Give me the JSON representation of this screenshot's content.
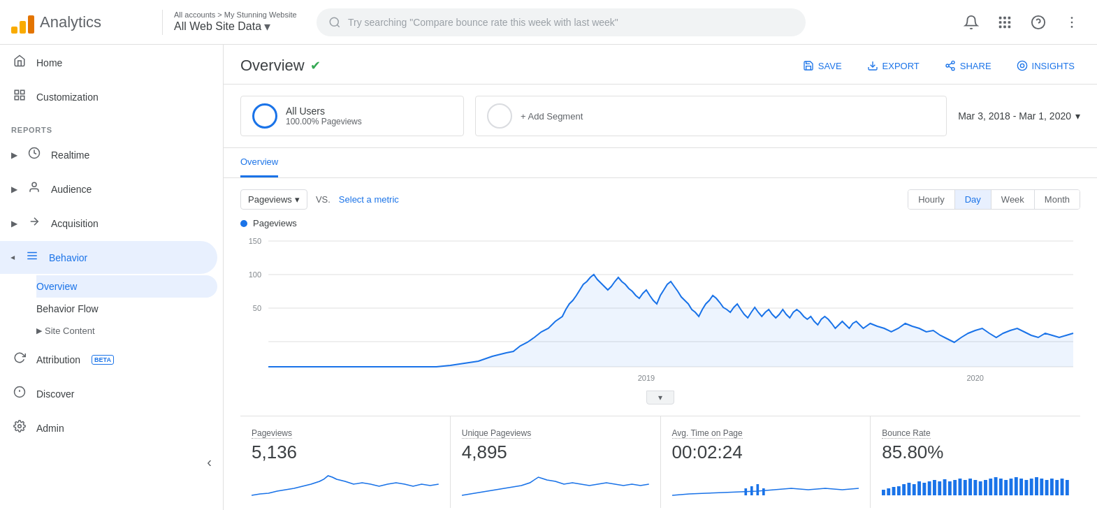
{
  "topbar": {
    "logo_title": "Analytics",
    "account_path": "All accounts > My Stunning Website",
    "account_name": "All Web Site Data",
    "search_placeholder": "Try searching \"Compare bounce rate this week with last week\""
  },
  "sidebar": {
    "nav_items": [
      {
        "id": "home",
        "label": "Home",
        "icon": "🏠",
        "active": false
      },
      {
        "id": "customization",
        "label": "Customization",
        "icon": "⊞",
        "active": false
      }
    ],
    "reports_label": "REPORTS",
    "report_items": [
      {
        "id": "realtime",
        "label": "Realtime",
        "icon": "⏱",
        "active": false,
        "has_arrow": true
      },
      {
        "id": "audience",
        "label": "Audience",
        "icon": "👤",
        "active": false,
        "has_arrow": true
      },
      {
        "id": "acquisition",
        "label": "Acquisition",
        "icon": "✦",
        "active": false,
        "has_arrow": true
      },
      {
        "id": "behavior",
        "label": "Behavior",
        "icon": "≡",
        "active": true,
        "has_arrow": true,
        "expanded": true
      }
    ],
    "behavior_subitems": [
      {
        "id": "overview",
        "label": "Overview",
        "active": true
      },
      {
        "id": "behavior_flow",
        "label": "Behavior Flow",
        "active": false
      },
      {
        "id": "site_content",
        "label": "Site Content",
        "active": false,
        "has_arrow": true,
        "collapsed": true
      }
    ],
    "bottom_items": [
      {
        "id": "attribution",
        "label": "Attribution",
        "icon": "↺",
        "active": false,
        "beta": true
      },
      {
        "id": "discover",
        "label": "Discover",
        "icon": "💡",
        "active": false
      },
      {
        "id": "admin",
        "label": "Admin",
        "icon": "⚙",
        "active": false
      }
    ],
    "collapse_label": "‹"
  },
  "overview_header": {
    "title": "Overview",
    "actions": [
      {
        "id": "save",
        "label": "SAVE",
        "icon": "💾"
      },
      {
        "id": "export",
        "label": "EXPORT",
        "icon": "⬇"
      },
      {
        "id": "share",
        "label": "SHARE",
        "icon": "↗"
      },
      {
        "id": "insights",
        "label": "INSIGHTS",
        "icon": "◎"
      }
    ]
  },
  "segment": {
    "all_users_label": "All Users",
    "all_users_sub": "100.00% Pageviews",
    "add_segment_label": "+ Add Segment",
    "date_range": "Mar 3, 2018 - Mar 1, 2020"
  },
  "tabs": [
    {
      "id": "overview",
      "label": "Overview",
      "active": true
    }
  ],
  "chart": {
    "metric_label": "Pageviews",
    "vs_label": "VS.",
    "select_metric_label": "Select a metric",
    "time_buttons": [
      {
        "id": "hourly",
        "label": "Hourly",
        "active": false
      },
      {
        "id": "day",
        "label": "Day",
        "active": true
      },
      {
        "id": "week",
        "label": "Week",
        "active": false
      },
      {
        "id": "month",
        "label": "Month",
        "active": false
      }
    ],
    "legend_label": "Pageviews",
    "y_labels": [
      "150",
      "100",
      "50",
      ""
    ],
    "x_labels": [
      "2019",
      "2020"
    ]
  },
  "stats": [
    {
      "id": "pageviews",
      "label": "Pageviews",
      "value": "5,136"
    },
    {
      "id": "unique_pageviews",
      "label": "Unique Pageviews",
      "value": "4,895"
    },
    {
      "id": "avg_time",
      "label": "Avg. Time on Page",
      "value": "00:02:24"
    },
    {
      "id": "bounce_rate",
      "label": "Bounce Rate",
      "value": "85.80%"
    }
  ]
}
